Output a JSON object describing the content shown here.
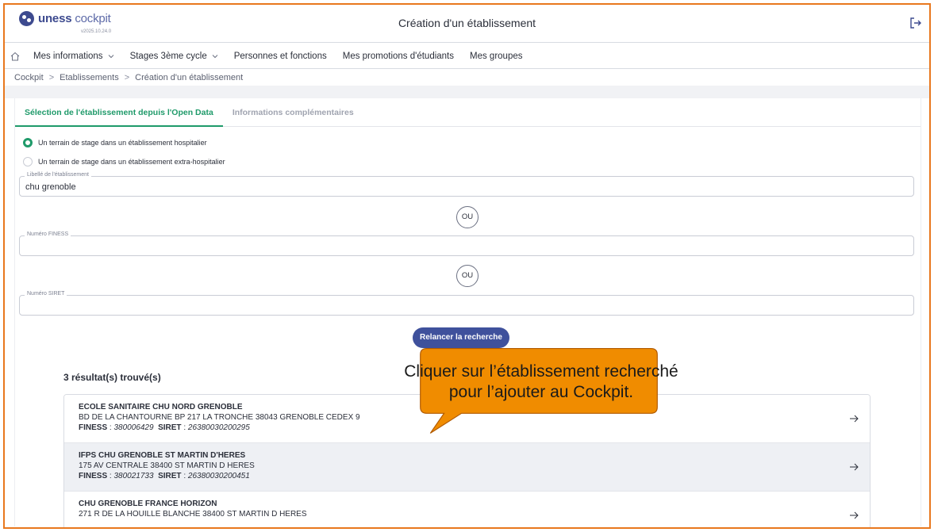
{
  "app": {
    "brand": "uness",
    "brand_suffix": "cockpit",
    "version": "v2025.10.24.0",
    "title": "Création d'un établissement"
  },
  "nav": {
    "items": [
      {
        "label": "Mes informations",
        "dropdown": true
      },
      {
        "label": "Stages 3ème cycle",
        "dropdown": true
      },
      {
        "label": "Personnes et fonctions",
        "dropdown": false
      },
      {
        "label": "Mes promotions d'étudiants",
        "dropdown": false
      },
      {
        "label": "Mes groupes",
        "dropdown": false
      }
    ]
  },
  "breadcrumb": [
    "Cockpit",
    "Etablissements",
    "Création d'un établissement"
  ],
  "tabs": [
    {
      "label": "Sélection de l'établissement depuis l'Open Data",
      "active": true
    },
    {
      "label": "Informations complémentaires",
      "active": false
    }
  ],
  "radios": [
    {
      "label": "Un terrain de stage dans un établissement hospitalier",
      "checked": true
    },
    {
      "label": "Un terrain de stage dans un établissement extra-hospitalier",
      "checked": false
    }
  ],
  "form": {
    "libelle_label": "Libellé de l'établissement",
    "libelle_value": "chu grenoble",
    "finess_label": "Numéro FINESS",
    "finess_value": "",
    "siret_label": "Numéro SIRET",
    "siret_value": "",
    "or_label": "OU",
    "search_button": "Relancer la recherche"
  },
  "results": {
    "title": "3 résultat(s) trouvé(s)",
    "finess_key": "FINESS",
    "siret_key": "SIRET",
    "items": [
      {
        "name": "ECOLE SANITAIRE CHU NORD GRENOBLE",
        "address": "BD DE LA CHANTOURNE BP 217 LA TRONCHE 38043 GRENOBLE CEDEX 9",
        "finess": "380006429",
        "siret": "26380030200295"
      },
      {
        "name": "IFPS CHU GRENOBLE ST MARTIN D'HERES",
        "address": "175 AV CENTRALE 38400 ST MARTIN D HERES",
        "finess": "380021733",
        "siret": "26380030200451"
      },
      {
        "name": "CHU GRENOBLE FRANCE HORIZON",
        "address": "271 R DE LA HOUILLE BLANCHE 38400 ST MARTIN D HERES",
        "finess": "",
        "siret": ""
      }
    ]
  },
  "callout": {
    "text": "Cliquer sur l’établissement recherché pour l’ajouter au Cockpit.",
    "fill": "#f08c00",
    "border": "#b05a00"
  },
  "colors": {
    "accent": "#1f9a6a",
    "brand": "#3d4a8f",
    "frame": "#e8781e"
  },
  "icons": [
    "home-icon",
    "logout-icon",
    "chevron-down-icon",
    "arrow-right-icon"
  ]
}
